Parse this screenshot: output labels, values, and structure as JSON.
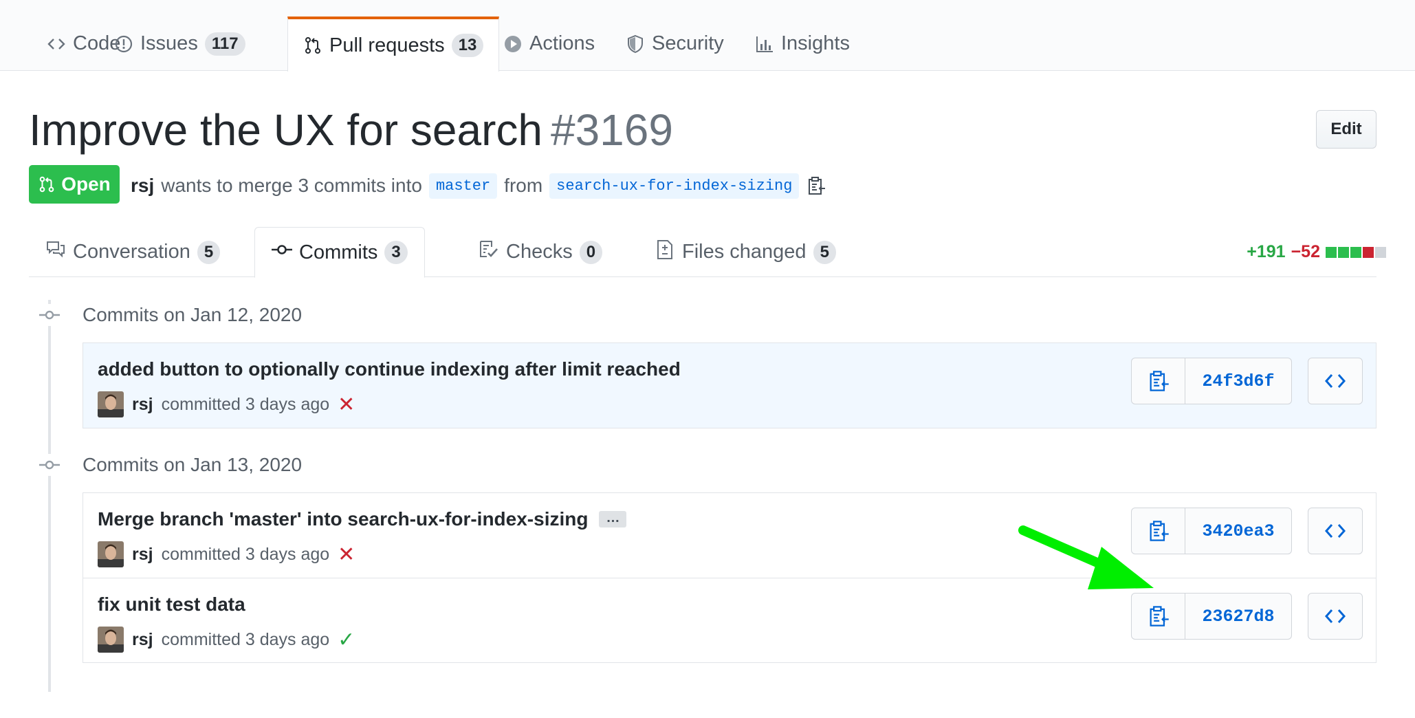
{
  "repo_nav": {
    "tabs": [
      {
        "label": "Code",
        "icon": "code-icon",
        "count": ""
      },
      {
        "label": "Issues",
        "icon": "issue-opened-icon",
        "count": "117"
      },
      {
        "label": "Pull requests",
        "icon": "git-pull-request-icon",
        "count": "13",
        "selected": true
      },
      {
        "label": "Actions",
        "icon": "play-icon",
        "count": ""
      },
      {
        "label": "Security",
        "icon": "shield-icon",
        "count": ""
      },
      {
        "label": "Insights",
        "icon": "graph-icon",
        "count": ""
      }
    ]
  },
  "pr": {
    "title": "Improve the UX for search",
    "number": "#3169",
    "edit_label": "Edit",
    "state": "Open",
    "author": "rsj",
    "merge_text": "wants to merge 3 commits into",
    "base_branch": "master",
    "from_text": "from",
    "head_branch": "search-ux-for-index-sizing"
  },
  "pr_tabs": [
    {
      "label": "Conversation",
      "icon": "comment-discussion-icon",
      "count": "5"
    },
    {
      "label": "Commits",
      "icon": "git-commit-icon",
      "count": "3",
      "selected": true
    },
    {
      "label": "Checks",
      "icon": "checklist-icon",
      "count": "0"
    },
    {
      "label": "Files changed",
      "icon": "file-diff-icon",
      "count": "5"
    }
  ],
  "diffstat": {
    "additions": "+191",
    "deletions": "−52"
  },
  "commit_groups": [
    {
      "heading": "Commits on Jan 12, 2020",
      "commits": [
        {
          "message": "added button to optionally continue indexing after limit reached",
          "author": "rsj",
          "when": "committed 3 days ago",
          "status": "failure",
          "sha": "24f3d6f"
        }
      ]
    },
    {
      "heading": "Commits on Jan 13, 2020",
      "commits": [
        {
          "message": "Merge branch 'master' into search-ux-for-index-sizing",
          "author": "rsj",
          "when": "committed 3 days ago",
          "status": "failure",
          "sha": "3420ea3",
          "has_more": true,
          "more_label": "…"
        },
        {
          "message": "fix unit test data",
          "author": "rsj",
          "when": "committed 3 days ago",
          "status": "success",
          "sha": "23627d8"
        }
      ]
    }
  ],
  "colors": {
    "accent": "#0366d6",
    "open": "#2cbe4e",
    "failure": "#cb2431",
    "success": "#28a745",
    "tab_active": "#e36209",
    "annotation_arrow": "#00ee00"
  }
}
